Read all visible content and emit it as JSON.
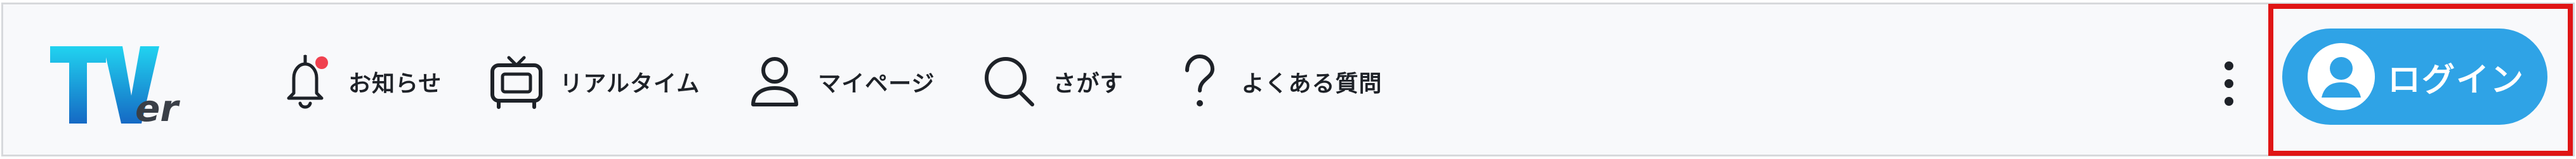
{
  "header": {
    "logo_text": "TVer",
    "nav": [
      {
        "label": "お知らせ",
        "icon": "bell-icon",
        "has_badge": true
      },
      {
        "label": "リアルタイム",
        "icon": "tv-icon"
      },
      {
        "label": "マイページ",
        "icon": "user-icon"
      },
      {
        "label": "さがす",
        "icon": "search-icon"
      },
      {
        "label": "よくある質問",
        "icon": "question-icon"
      }
    ],
    "more_icon": "more-vertical-icon",
    "login_label": "ログイン",
    "login_icon": "user-avatar-icon"
  },
  "colors": {
    "logo_gradient_top": "#21d3f0",
    "logo_gradient_bottom": "#1569c4",
    "login_button": "#2fa3e6",
    "highlight_border": "#e01515",
    "notification_badge": "#f0414f",
    "text": "#1e2228"
  }
}
